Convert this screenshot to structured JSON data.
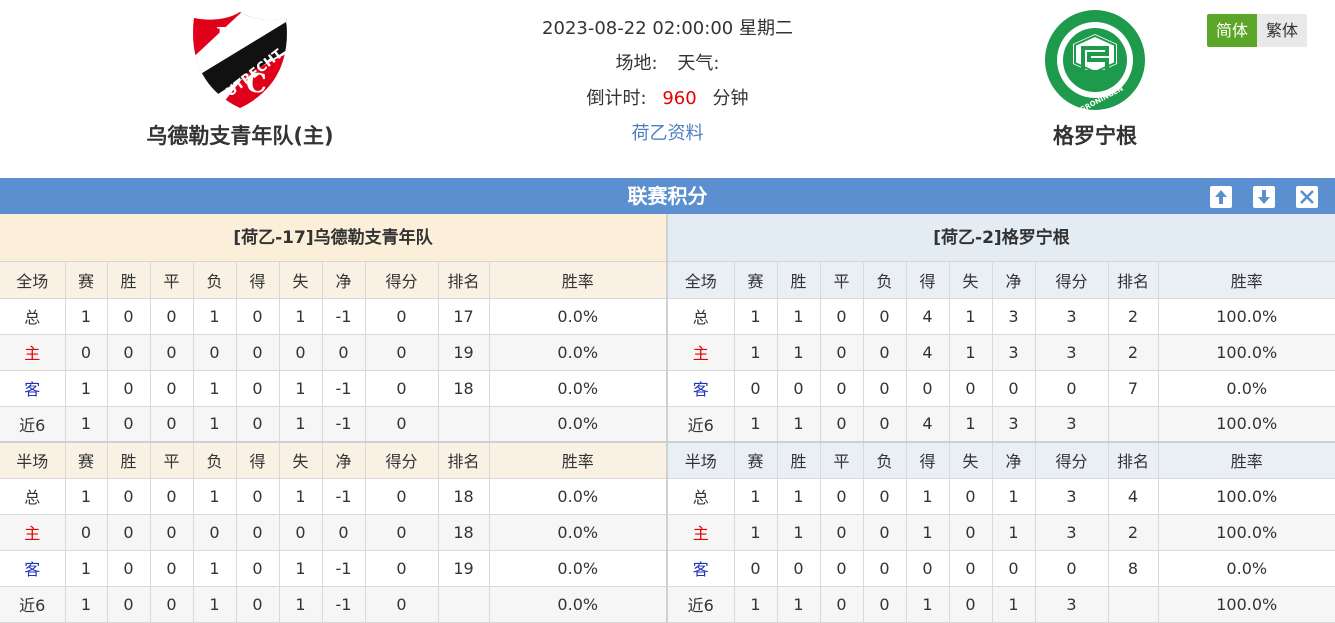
{
  "header": {
    "home_team": "乌德勒支青年队(主)",
    "away_team": "格罗宁根",
    "datetime": "2023-08-22 02:00:00 星期二",
    "venue_label": "场地:",
    "weather_label": "天气:",
    "countdown_label": "倒计时:",
    "countdown_value": "960",
    "countdown_unit": "分钟",
    "league_link": "荷乙资料"
  },
  "home_logo": {
    "letters": [
      "F",
      "C"
    ],
    "ring_text": "UTRECHT",
    "colors": {
      "red": "#e1001a",
      "black": "#111111",
      "white": "#ffffff"
    }
  },
  "away_logo": {
    "ring_text": "FC GRONINGEN",
    "colors": {
      "green": "#1e9a4c",
      "white": "#ffffff"
    }
  },
  "lang": {
    "simplified": "简体",
    "traditional": "繁体"
  },
  "section": {
    "title": "联赛积分",
    "icons": [
      "arrow-up-icon",
      "arrow-down-icon",
      "close-icon"
    ]
  },
  "colors": {
    "title_bar": "#5b8fcf",
    "accent_green": "#5ba528",
    "home_label": "#e60000",
    "away_label": "#2233bb",
    "countdown": "#e60000",
    "link": "#4d7fc0"
  },
  "home_table": {
    "caption": "[荷乙-17]乌德勒支青年队",
    "full_header": [
      "全场",
      "赛",
      "胜",
      "平",
      "负",
      "得",
      "失",
      "净",
      "得分",
      "排名",
      "胜率"
    ],
    "full_rows": [
      [
        "总",
        "1",
        "0",
        "0",
        "1",
        "0",
        "1",
        "-1",
        "0",
        "17",
        "0.0%"
      ],
      [
        "主",
        "0",
        "0",
        "0",
        "0",
        "0",
        "0",
        "0",
        "0",
        "19",
        "0.0%"
      ],
      [
        "客",
        "1",
        "0",
        "0",
        "1",
        "0",
        "1",
        "-1",
        "0",
        "18",
        "0.0%"
      ],
      [
        "近6",
        "1",
        "0",
        "0",
        "1",
        "0",
        "1",
        "-1",
        "0",
        "",
        "0.0%"
      ]
    ],
    "half_header": [
      "半场",
      "赛",
      "胜",
      "平",
      "负",
      "得",
      "失",
      "净",
      "得分",
      "排名",
      "胜率"
    ],
    "half_rows": [
      [
        "总",
        "1",
        "0",
        "0",
        "1",
        "0",
        "1",
        "-1",
        "0",
        "18",
        "0.0%"
      ],
      [
        "主",
        "0",
        "0",
        "0",
        "0",
        "0",
        "0",
        "0",
        "0",
        "18",
        "0.0%"
      ],
      [
        "客",
        "1",
        "0",
        "0",
        "1",
        "0",
        "1",
        "-1",
        "0",
        "19",
        "0.0%"
      ],
      [
        "近6",
        "1",
        "0",
        "0",
        "1",
        "0",
        "1",
        "-1",
        "0",
        "",
        "0.0%"
      ]
    ]
  },
  "away_table": {
    "caption": "[荷乙-2]格罗宁根",
    "full_header": [
      "全场",
      "赛",
      "胜",
      "平",
      "负",
      "得",
      "失",
      "净",
      "得分",
      "排名",
      "胜率"
    ],
    "full_rows": [
      [
        "总",
        "1",
        "1",
        "0",
        "0",
        "4",
        "1",
        "3",
        "3",
        "2",
        "100.0%"
      ],
      [
        "主",
        "1",
        "1",
        "0",
        "0",
        "4",
        "1",
        "3",
        "3",
        "2",
        "100.0%"
      ],
      [
        "客",
        "0",
        "0",
        "0",
        "0",
        "0",
        "0",
        "0",
        "0",
        "7",
        "0.0%"
      ],
      [
        "近6",
        "1",
        "1",
        "0",
        "0",
        "4",
        "1",
        "3",
        "3",
        "",
        "100.0%"
      ]
    ],
    "half_header": [
      "半场",
      "赛",
      "胜",
      "平",
      "负",
      "得",
      "失",
      "净",
      "得分",
      "排名",
      "胜率"
    ],
    "half_rows": [
      [
        "总",
        "1",
        "1",
        "0",
        "0",
        "1",
        "0",
        "1",
        "3",
        "4",
        "100.0%"
      ],
      [
        "主",
        "1",
        "1",
        "0",
        "0",
        "1",
        "0",
        "1",
        "3",
        "2",
        "100.0%"
      ],
      [
        "客",
        "0",
        "0",
        "0",
        "0",
        "0",
        "0",
        "0",
        "0",
        "8",
        "0.0%"
      ],
      [
        "近6",
        "1",
        "1",
        "0",
        "0",
        "1",
        "0",
        "1",
        "3",
        "",
        "100.0%"
      ]
    ]
  }
}
